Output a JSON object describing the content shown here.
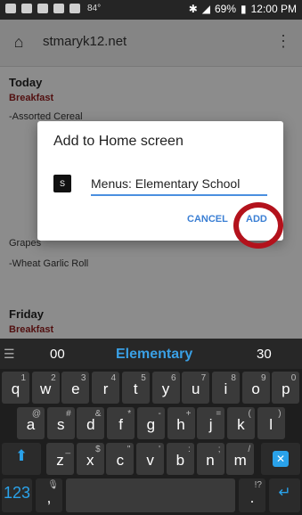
{
  "status": {
    "temperature": "84°",
    "battery": "69%",
    "time": "12:00 PM"
  },
  "browser": {
    "url": "stmaryk12.net"
  },
  "page": {
    "day1": "Today",
    "meal1": "Breakfast",
    "item1": "-Assorted Cereal",
    "item2": "Grapes",
    "item3": "-Wheat Garlic Roll",
    "day2": "Friday",
    "meal2": "Breakfast"
  },
  "dialog": {
    "title": "Add to Home screen",
    "favicon_letter": "S",
    "shortcut_name": "Menus: Elementary School",
    "cancel_label": "CANCEL",
    "add_label": "ADD"
  },
  "keyboard": {
    "suggestions": [
      "00",
      "Elementary",
      "30"
    ],
    "row1": [
      {
        "k": "q",
        "a": "1"
      },
      {
        "k": "w",
        "a": "2"
      },
      {
        "k": "e",
        "a": "3"
      },
      {
        "k": "r",
        "a": "4"
      },
      {
        "k": "t",
        "a": "5"
      },
      {
        "k": "y",
        "a": "6"
      },
      {
        "k": "u",
        "a": "7"
      },
      {
        "k": "i",
        "a": "8"
      },
      {
        "k": "o",
        "a": "9"
      },
      {
        "k": "p",
        "a": "0"
      }
    ],
    "row2": [
      {
        "k": "a",
        "a": "@"
      },
      {
        "k": "s",
        "a": "#"
      },
      {
        "k": "d",
        "a": "&"
      },
      {
        "k": "f",
        "a": "*"
      },
      {
        "k": "g",
        "a": "-"
      },
      {
        "k": "h",
        "a": "+"
      },
      {
        "k": "j",
        "a": "="
      },
      {
        "k": "k",
        "a": "("
      },
      {
        "k": "l",
        "a": ")"
      }
    ],
    "row3": [
      {
        "k": "z",
        "a": "_"
      },
      {
        "k": "x",
        "a": "$"
      },
      {
        "k": "c",
        "a": "\""
      },
      {
        "k": "v",
        "a": "'"
      },
      {
        "k": "b",
        "a": ":"
      },
      {
        "k": "n",
        "a": ";"
      },
      {
        "k": "m",
        "a": "/"
      }
    ],
    "num_label": "123",
    "comma": ",",
    "period": ".",
    "period_alt": "!?"
  }
}
